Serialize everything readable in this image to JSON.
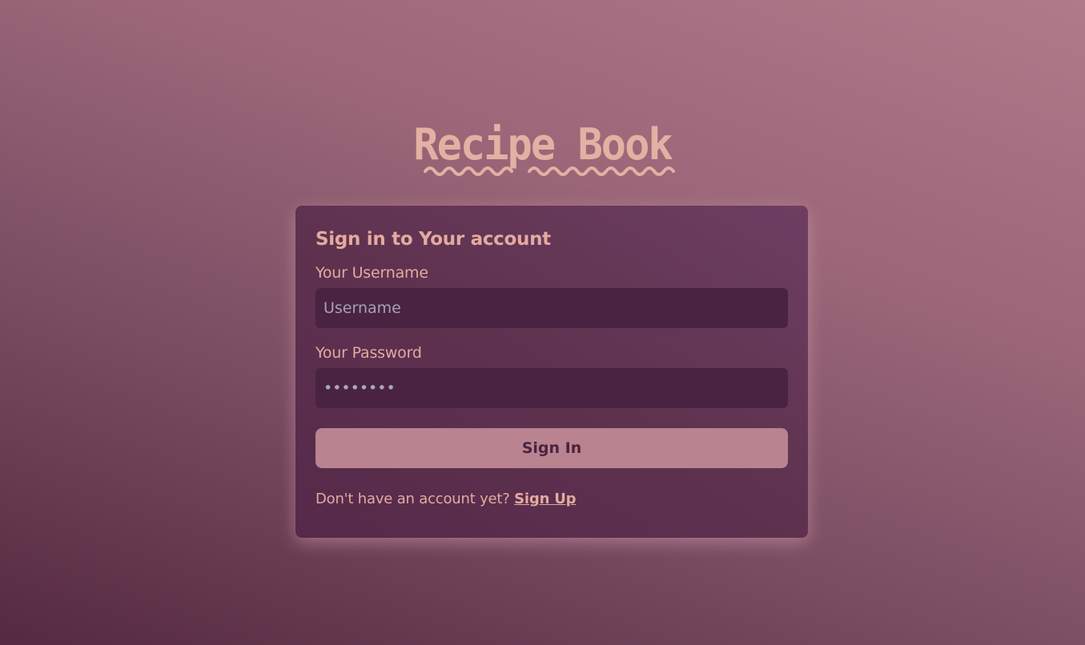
{
  "logo": {
    "text": "Recipe Book"
  },
  "form": {
    "title": "Sign in to Your account",
    "username_label": "Your Username",
    "username_placeholder": "Username",
    "password_label": "Your Password",
    "password_value": "••••••••",
    "submit_label": "Sign In",
    "signup_prompt": "Don't have an account yet? ",
    "signup_link": "Sign Up"
  },
  "colors": {
    "accent": "#e3aaa0",
    "button": "#b9838f",
    "card": "#5e324f",
    "input_bg": "#4a2342"
  }
}
